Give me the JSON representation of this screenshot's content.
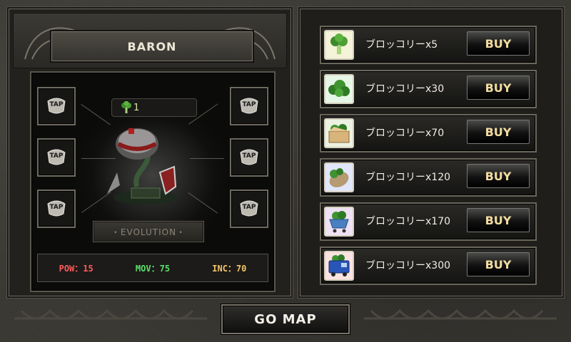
{
  "character": {
    "name": "BARON"
  },
  "counter": {
    "icon": "broccoli-icon",
    "value": "1"
  },
  "tap_slots": [
    "TAP",
    "TAP",
    "TAP",
    "TAP",
    "TAP",
    "TAP"
  ],
  "evolution": {
    "label": "・EVOLUTION・"
  },
  "stats": {
    "pow": {
      "text": "POW：15",
      "color": "#ff5a5a"
    },
    "mov": {
      "text": "MOV：75",
      "color": "#5ee06a"
    },
    "inc": {
      "text": "INC：70",
      "color": "#f2c46a"
    }
  },
  "shop": {
    "items": [
      {
        "label": "ブロッコリーx5",
        "buy": "BUY",
        "icon": "broccoli-single-icon"
      },
      {
        "label": "ブロッコリーx30",
        "buy": "BUY",
        "icon": "broccoli-bunch-icon"
      },
      {
        "label": "ブロッコリーx70",
        "buy": "BUY",
        "icon": "broccoli-box-icon"
      },
      {
        "label": "ブロッコリーx120",
        "buy": "BUY",
        "icon": "broccoli-sack-icon"
      },
      {
        "label": "ブロッコリーx170",
        "buy": "BUY",
        "icon": "broccoli-cart-icon"
      },
      {
        "label": "ブロッコリーx300",
        "buy": "BUY",
        "icon": "broccoli-truck-icon"
      }
    ]
  },
  "go_map": {
    "label": "GO MAP"
  }
}
